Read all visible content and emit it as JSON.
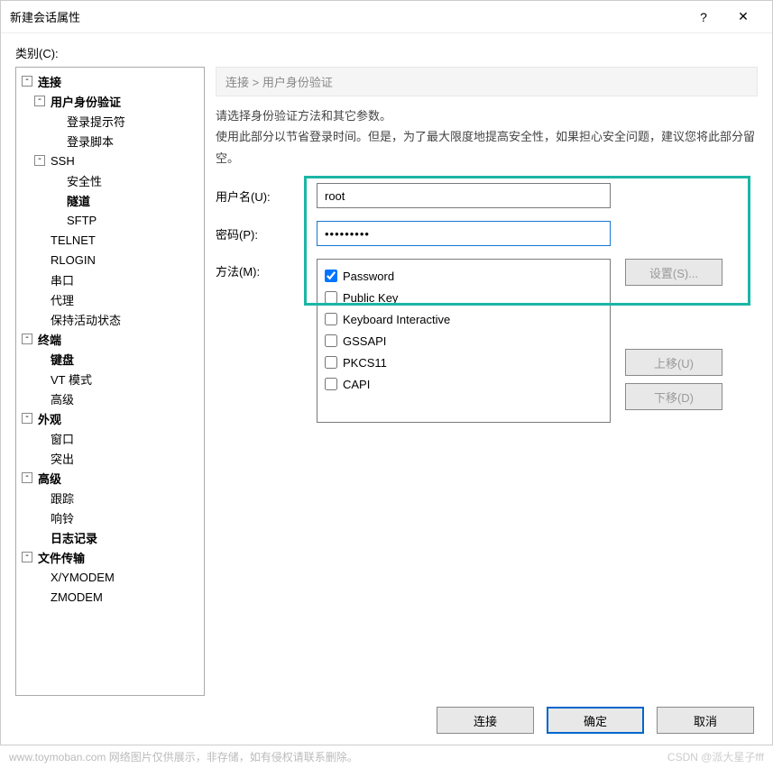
{
  "titlebar": {
    "title": "新建会话属性",
    "help": "?",
    "close": "✕"
  },
  "category_label": "类别(C):",
  "tree": [
    {
      "label": "连接",
      "bold": true,
      "level": 0,
      "expand": true,
      "children": [
        {
          "label": "用户身份验证",
          "bold": true,
          "level": 1,
          "expand": true,
          "children": [
            {
              "label": "登录提示符",
              "level": 2
            },
            {
              "label": "登录脚本",
              "level": 2
            }
          ]
        },
        {
          "label": "SSH",
          "level": 1,
          "expand": true,
          "children": [
            {
              "label": "安全性",
              "level": 2
            },
            {
              "label": "隧道",
              "bold": true,
              "level": 2
            },
            {
              "label": "SFTP",
              "level": 2
            }
          ]
        },
        {
          "label": "TELNET",
          "level": 1
        },
        {
          "label": "RLOGIN",
          "level": 1
        },
        {
          "label": "串口",
          "level": 1
        },
        {
          "label": "代理",
          "level": 1
        },
        {
          "label": "保持活动状态",
          "level": 1
        }
      ]
    },
    {
      "label": "终端",
      "bold": true,
      "level": 0,
      "expand": true,
      "children": [
        {
          "label": "键盘",
          "bold": true,
          "level": 1
        },
        {
          "label": "VT 模式",
          "level": 1
        },
        {
          "label": "高级",
          "level": 1
        }
      ]
    },
    {
      "label": "外观",
      "bold": true,
      "level": 0,
      "expand": true,
      "children": [
        {
          "label": "窗口",
          "level": 1
        },
        {
          "label": "突出",
          "level": 1
        }
      ]
    },
    {
      "label": "高级",
      "bold": true,
      "level": 0,
      "expand": true,
      "children": [
        {
          "label": "跟踪",
          "level": 1
        },
        {
          "label": "响铃",
          "level": 1
        },
        {
          "label": "日志记录",
          "bold": true,
          "level": 1
        }
      ]
    },
    {
      "label": "文件传输",
      "bold": true,
      "level": 0,
      "expand": true,
      "children": [
        {
          "label": "X/YMODEM",
          "level": 1
        },
        {
          "label": "ZMODEM",
          "level": 1
        }
      ]
    }
  ],
  "breadcrumb": "连接 > 用户身份验证",
  "description": {
    "line1": "请选择身份验证方法和其它参数。",
    "line2": "使用此部分以节省登录时间。但是，为了最大限度地提高安全性，如果担心安全问题，建议您将此部分留空。"
  },
  "form": {
    "username_label": "用户名(U):",
    "username_value": "root",
    "password_label": "密码(P):",
    "password_value": "•••••••••",
    "method_label": "方法(M):",
    "methods": [
      {
        "label": "Password",
        "checked": true
      },
      {
        "label": "Public Key",
        "checked": false
      },
      {
        "label": "Keyboard Interactive",
        "checked": false
      },
      {
        "label": "GSSAPI",
        "checked": false
      },
      {
        "label": "PKCS11",
        "checked": false
      },
      {
        "label": "CAPI",
        "checked": false
      }
    ]
  },
  "buttons": {
    "settings": "设置(S)...",
    "up": "上移(U)",
    "down": "下移(D)",
    "connect": "连接",
    "ok": "确定",
    "cancel": "取消"
  },
  "watermark": {
    "left": "www.toymoban.com  网络图片仅供展示，非存储，如有侵权请联系删除。",
    "right": "CSDN @派大星子fff"
  }
}
